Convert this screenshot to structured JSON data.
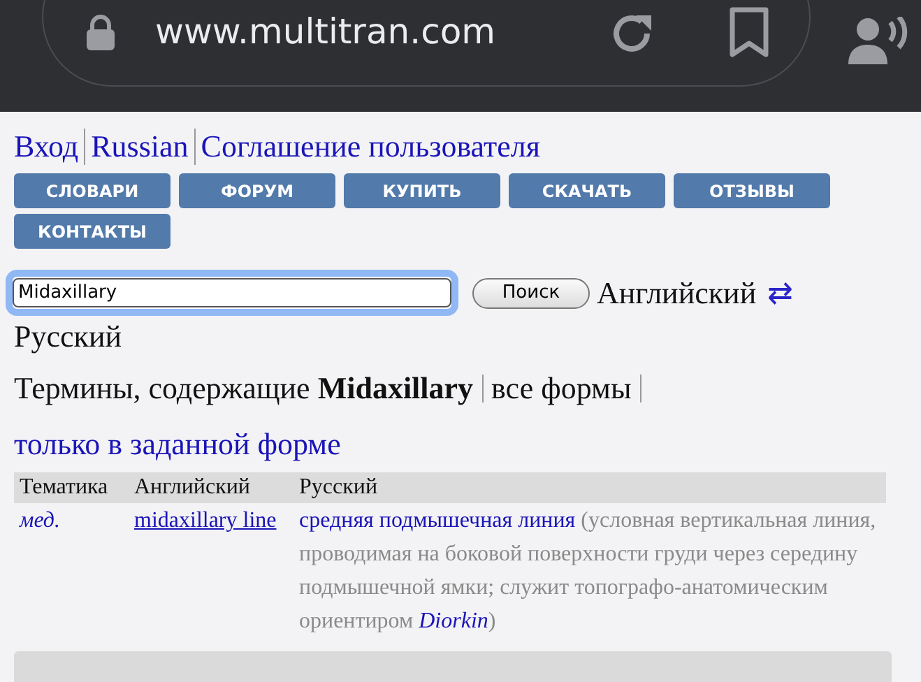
{
  "browser": {
    "url": "www.multitran.com"
  },
  "top_links": [
    {
      "label": "Вход"
    },
    {
      "label": "Russian"
    },
    {
      "label": "Соглашение пользователя"
    }
  ],
  "nav_buttons": [
    {
      "label": "СЛОВАРИ"
    },
    {
      "label": "ФОРУМ"
    },
    {
      "label": "КУПИТЬ"
    },
    {
      "label": "СКАЧАТЬ"
    },
    {
      "label": "ОТЗЫВЫ"
    },
    {
      "label": "КОНТАКТЫ"
    }
  ],
  "search": {
    "value": "Midaxillary",
    "button": "Поиск",
    "source_language": "Английский",
    "swap": "⇄",
    "target_language": "Русский"
  },
  "results_heading": {
    "prefix": "Термины, содержащие",
    "term": "Midaxillary",
    "all_forms": "все формы",
    "exact_form": "только в заданной форме"
  },
  "table": {
    "columns": [
      "Тематика",
      "Английский",
      "Русский"
    ],
    "rows": [
      {
        "subject": "мед.",
        "term": "midaxillary line",
        "translation": "средняя подмышечная линия",
        "comment": "(условная вертикальная линия, проводимая на боковой поверхности груди через середину подмышечной ямки; служит топографо-анатомическим ориентиром",
        "author": "Diorkin",
        "comment_end": ")"
      }
    ]
  }
}
